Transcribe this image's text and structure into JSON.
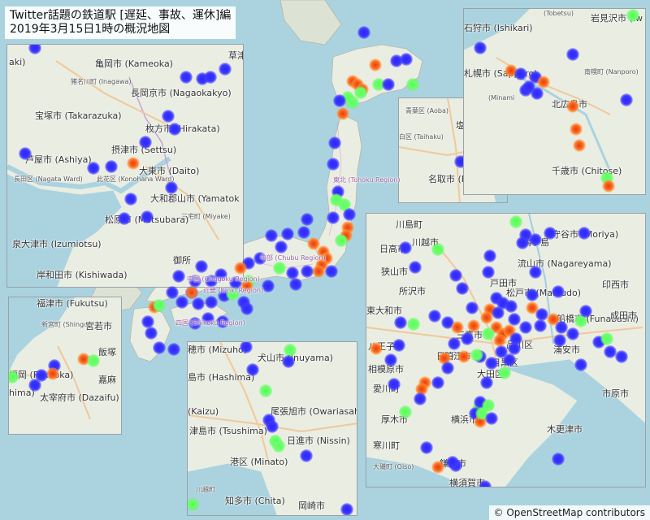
{
  "title": {
    "line1": "Twitter話題の鉄道駅 [遅延、事故、運休]編",
    "line2": "2019年3月15日1時の概況地図"
  },
  "attribution": "© OpenStreetMap contributors",
  "colors": {
    "sea": "#aad3df",
    "land": "#e9ede2",
    "blue": "#3a36ff",
    "green": "#6cff6c",
    "orange": "#ff6a20"
  },
  "insets": {
    "osaka": {
      "cities": [
        "草津",
        "亀岡市 (Kameoka)",
        "猪名川町 (Inagawa)",
        "長岡京市 (Nagaokakyo)",
        "宝塚市 (Takarazuka)",
        "枚方市 (Hirakata)",
        "摂津市 (Settsu)",
        "芦屋市 (Ashiya)",
        "大東市 (Daito)",
        "長田区 (Nagata Ward)",
        "此花区 (Konohana Ward)",
        "大和郡山市 (Yamatok",
        "三宅町 (Miyake)",
        "松原市 (Matsubara)",
        "泉大津市 (Izumiotsu)",
        "御所",
        "岸和田市 (Kishiwada)",
        "aki)"
      ],
      "dots": [
        [
          "blue",
          0.12
        ],
        [
          "blue",
          0.14
        ],
        [
          "blue",
          0.2
        ],
        [
          "blue",
          0.2
        ],
        [
          "blue",
          0.12
        ],
        [
          "blue",
          0.12
        ],
        [
          "blue",
          0.12
        ],
        [
          "orange",
          0.1
        ],
        [
          "blue",
          0.1
        ],
        [
          "blue",
          0.1
        ],
        [
          "blue",
          0.1
        ],
        [
          "blue",
          0.1
        ],
        [
          "blue",
          0.1
        ]
      ]
    },
    "fukuoka": {
      "cities": [
        "福津市 (Fukutsu)",
        "新宮町 (Shingu)",
        "宮若市",
        "飯塚",
        "福岡 (Fukuoka)",
        "嘉麻",
        "太宰府市 (Dazaifu)",
        "hima)"
      ]
    },
    "sendai": {
      "cities": [
        "青葉区 (Aoba)",
        "塩竈市 (Shi",
        "白区 (Taihaku)",
        "名取市 (Natori)"
      ]
    },
    "sapporo": {
      "cities": [
        "(Tobetsu)",
        "岩見沢市 (Iw",
        "石狩市 (Ishikari)",
        "札幌市 (Sapporo)",
        "南幌町 (Nanporo)",
        "北広島市",
        "(Minami",
        "千歳市 (Chitose)"
      ]
    },
    "nagoya": {
      "cities": [
        "穂市 (Mizuho)",
        "犬山市 (Inuyama)",
        "島市 (Hashima)",
        "尾張旭市 (Owariasahi)",
        "(Kaizu)",
        "津島市 (Tsushima)",
        "日進市 (Nissin)",
        "港区 (Minato)",
        "川越町",
        "知多市 (Chita)",
        "岡崎市"
      ]
    },
    "tokyo": {
      "cities": [
        "川島町",
        "守谷市 (Moriya)",
        "日高市",
        "川越市",
        "鶴ヶ島",
        "狭山市",
        "流山市 (Nagareyama)",
        "戸田市",
        "所沢市",
        "印西市",
        "松戸市 (Matsudo)",
        "東大和市",
        "船橋市 (Funabashi)",
        "八王子市",
        "三鷹市",
        "相模原市",
        "大田区",
        "厚木市",
        "横浜市",
        "寒川町",
        "市原市",
        "木更津市",
        "大磯町 (Oiso)",
        "鎌倉市",
        "横須賀市",
        "愛川町",
        "日野市",
        "狛江市",
        "目黒区",
        "品川区",
        "浦安市",
        "成田市"
      ]
    }
  },
  "main_labels": [
    "中部 (Chubu Region)",
    "近畿 (Kinki Region)",
    "中国 (Chugoku Region)",
    "四国 (Shikoku Region)",
    "東北 (Tohoku Region)"
  ]
}
